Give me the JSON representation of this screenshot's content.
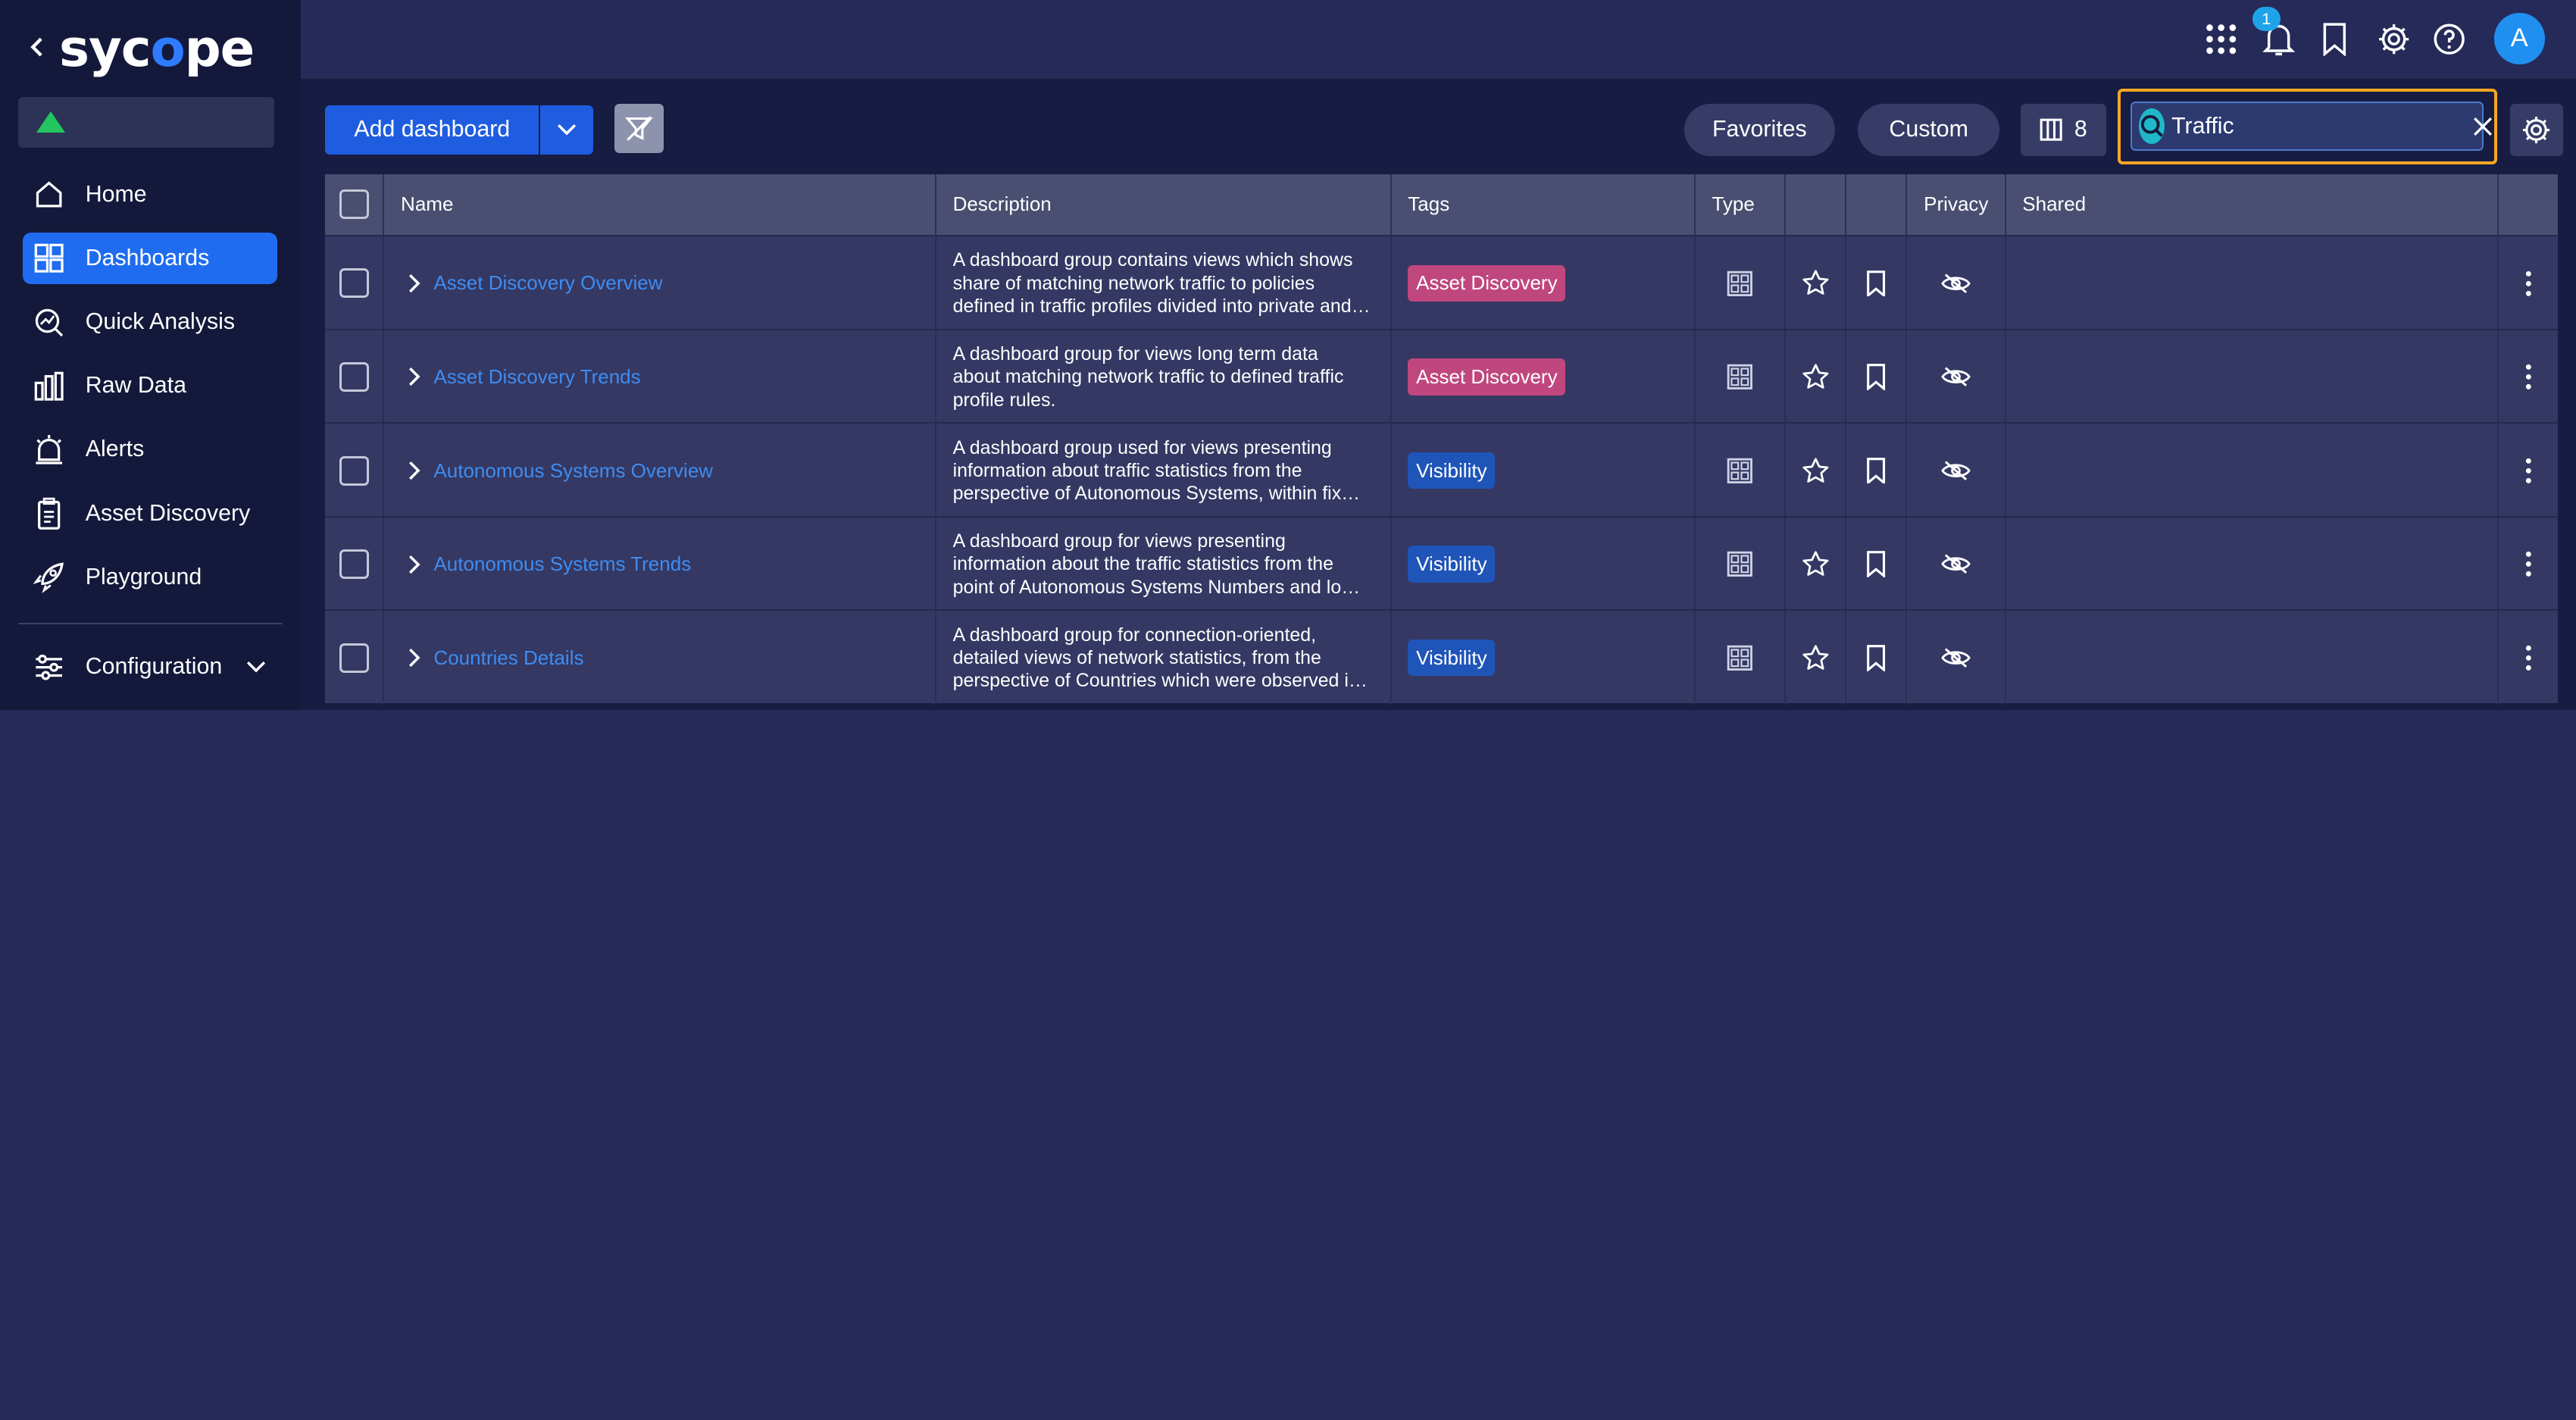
{
  "app": {
    "logo_text_pre": "syc",
    "logo_text_o": "o",
    "logo_text_post": "pe"
  },
  "colors": {
    "sidebar_bg": "#14193b",
    "main_bg": "#171c42",
    "accent": "#1f5de0",
    "active_nav": "#1f6cf0",
    "search_focus": "#f5a623",
    "status_ok": "#22c55e",
    "tag_asset_discovery": "#c0477e",
    "tag_visibility": "#1f54b8",
    "link": "#3f8cf0"
  },
  "sidebar": {
    "items": [
      {
        "label": "Home",
        "icon": "home-icon",
        "active": false
      },
      {
        "label": "Dashboards",
        "icon": "dashboards-icon",
        "active": true
      },
      {
        "label": "Quick Analysis",
        "icon": "quick-analysis-icon",
        "active": false
      },
      {
        "label": "Raw Data",
        "icon": "raw-data-icon",
        "active": false
      },
      {
        "label": "Alerts",
        "icon": "alarm-icon",
        "active": false
      },
      {
        "label": "Asset Discovery",
        "icon": "clipboard-icon",
        "active": false
      },
      {
        "label": "Playground",
        "icon": "rocket-icon",
        "active": false
      }
    ],
    "config_label": "Configuration"
  },
  "topbar": {
    "notification_count": "1",
    "avatar_letter": "A"
  },
  "toolbar": {
    "add_label": "Add dashboard",
    "favorites_label": "Favorites",
    "custom_label": "Custom",
    "columns_count": "8",
    "search_value": "Traffic"
  },
  "table": {
    "headers": {
      "name": "Name",
      "description": "Description",
      "tags": "Tags",
      "type": "Type",
      "privacy": "Privacy",
      "shared": "Shared"
    },
    "rows": [
      {
        "name": "Asset Discovery Overview",
        "description": "A dashboard group contains views which shows share of matching network traffic to policies defined in traffic profiles divided into private and public networks.",
        "tag": "Asset Discovery",
        "tag_color": "#c0477e"
      },
      {
        "name": "Asset Discovery Trends",
        "description": "A dashboard group for views long term data about matching network traffic to defined traffic profile rules.",
        "tag": "Asset Discovery",
        "tag_color": "#c0477e"
      },
      {
        "name": "Autonomous Systems Overview",
        "description": "A dashboard group used for views presenting information about traffic statistics from the perspective of Autonomous Systems, within fixed time ranges.",
        "tag": "Visibility",
        "tag_color": "#1f54b8"
      },
      {
        "name": "Autonomous Systems Trends",
        "description": "A dashboard group for views presenting information about the traffic statistics from the point of Autonomous Systems Numbers and long term trends.",
        "tag": "Visibility",
        "tag_color": "#1f54b8"
      },
      {
        "name": "Countries Details",
        "description": "A dashboard group for connection-oriented, detailed views of network statistics, from the perspective of Countries which were observed in the traffic.",
        "tag": "Visibility",
        "tag_color": "#1f54b8"
      }
    ]
  }
}
